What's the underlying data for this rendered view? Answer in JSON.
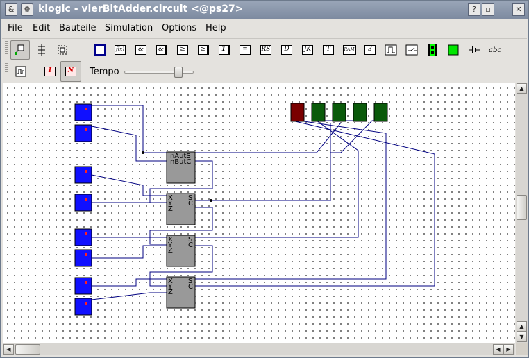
{
  "window": {
    "title": "klogic - vierBitAdder.circuit <@ps27>",
    "app_icon": "&",
    "title_buttons": [
      "help-icon",
      "minimize-icon",
      "maximize-icon",
      "close-icon"
    ]
  },
  "menu": [
    "File",
    "Edit",
    "Bauteile",
    "Simulation",
    "Options",
    "Help"
  ],
  "toolbar1": {
    "gate_labels": [
      "&",
      "&",
      "≥",
      "≥",
      "1",
      "=",
      "RS",
      "D",
      "JK",
      "T",
      "RAM",
      "3",
      "abc"
    ],
    "icons": [
      "select-tool-icon",
      "wire-tool-icon",
      "group-tool-icon",
      "subcircuit-icon",
      "equation-icon",
      "and-gate-icon",
      "nand-gate-icon",
      "or-gate-icon",
      "nor-gate-icon",
      "inverter-icon",
      "xor-gate-icon",
      "rs-flipflop-icon",
      "d-flipflop-icon",
      "jk-flipflop-icon",
      "t-flipflop-icon",
      "ram-icon",
      "tristate-icon",
      "clock-icon",
      "switch-icon",
      "led-display-icon",
      "led-icon",
      "power-icon",
      "text-icon"
    ]
  },
  "toolbar2": {
    "tempo_label": "Tempo",
    "tempo_value": 0.83,
    "mode_i": "I",
    "mode_n": "N"
  },
  "circuit": {
    "inputs_colors": {
      "input": "#1010ff",
      "led_on": "#ff2020"
    },
    "outputs_colors": {
      "red": "#7a0000",
      "green": "#0a5a0a"
    },
    "adder_top_labels": {
      "l1": "InAutS",
      "l2": "InButC"
    },
    "adder_labels": {
      "x": "X",
      "y": "Y",
      "z": "Z",
      "s": "S",
      "c": "C"
    },
    "wire_color": "#000080"
  }
}
